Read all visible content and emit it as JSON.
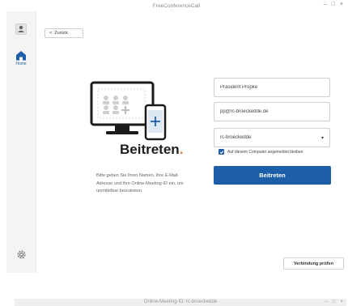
{
  "window": {
    "title": "FreeConferenceCall",
    "controls": [
      "–",
      "□",
      "×"
    ]
  },
  "sidebar": {
    "home_label": "Home"
  },
  "nav": {
    "back_label": "Zurück"
  },
  "main": {
    "heading": "Beitreten",
    "heading_dot": ".",
    "description": "Bitte geben Sie Ihren Namen, Ihre E-Mail-Adresse und Ihre Online-Meeting-ID ein, um unmittelbar beizutreten."
  },
  "form": {
    "name_value": "Präsident Pröpke",
    "email_value": "pp@rc-broeckedde.de",
    "meeting_id_value": "rc-broeckedde",
    "remember_label": "Auf diesem Computer angemeldet bleiben",
    "remember_checked": true,
    "join_label": "Beitreten"
  },
  "footer": {
    "test_connection_label": "Verbindung prüfen"
  },
  "second_window": {
    "title": "Online-Meeting-ID: rc-broeckedde",
    "controls": [
      "–",
      "□",
      "×"
    ]
  },
  "colors": {
    "accent": "#1c5ea8",
    "brand_orange": "#f07a23"
  }
}
